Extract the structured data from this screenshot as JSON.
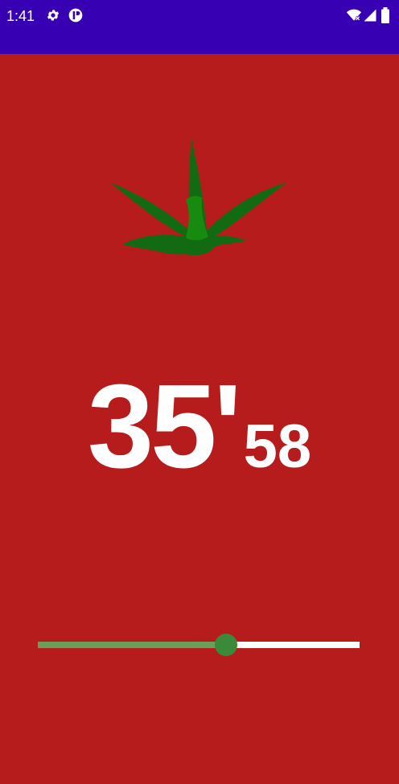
{
  "status_bar": {
    "time": "1:41",
    "icons_left": [
      "gear-icon",
      "sync-icon"
    ],
    "icons_right": [
      "wifi-off-icon",
      "signal-icon",
      "battery-icon"
    ],
    "color": "#3700b3"
  },
  "app": {
    "background_color": "#b71c1c",
    "stem_icon": "tomato-stem-icon",
    "timer": {
      "minutes": "35",
      "minutes_mark": "'",
      "seconds": "58"
    },
    "slider": {
      "value_fraction": 0.585,
      "fill_color": "#6a9f5a",
      "thumb_color": "#3a8a3a",
      "track_color": "#ffffff"
    }
  }
}
